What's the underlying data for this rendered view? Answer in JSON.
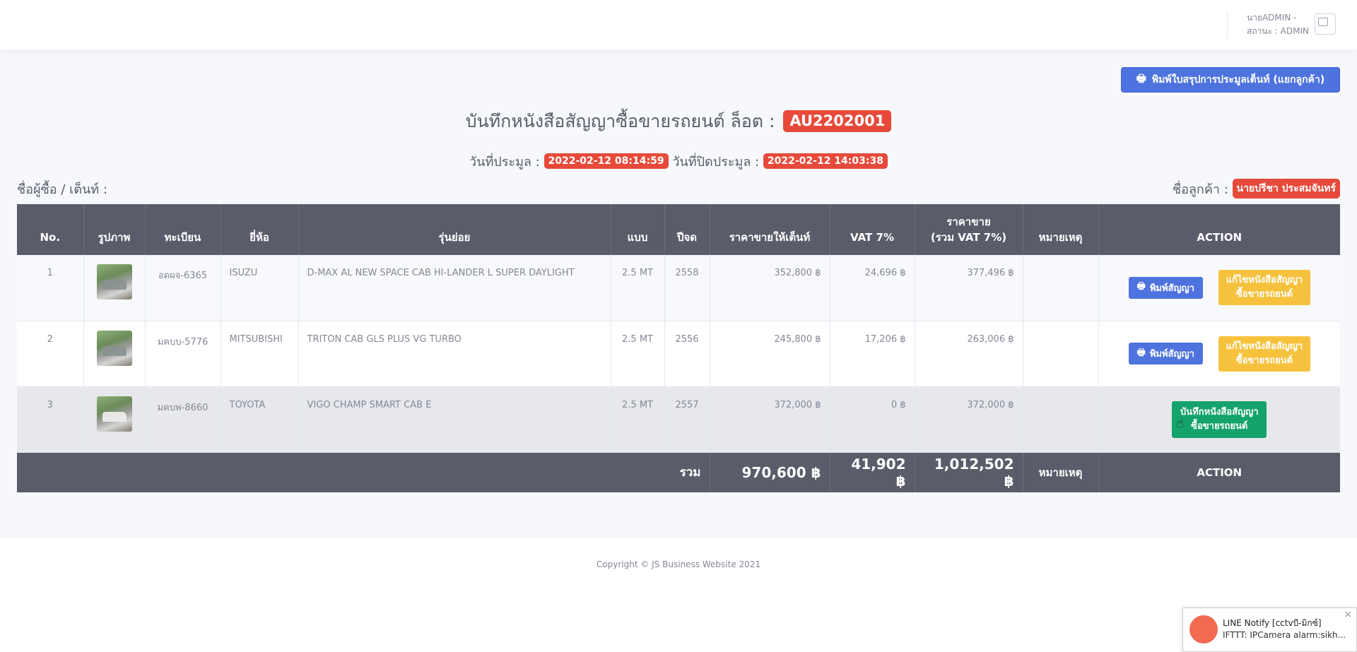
{
  "topbar": {
    "user_name": "นายADMIN -",
    "user_status": "สถานะ : ADMIN"
  },
  "print_summary_button": {
    "icon": "printer-icon",
    "label": "พิมพ์ใบสรุปการประมูลเต็นท์ (แยกลูกค้า)"
  },
  "header": {
    "title": "บันทึกหนังสือสัญญาซื้อขายรถยนต์ ล็อต :",
    "lot": "AU2202001",
    "auction_date_label": "วันที่ประมูล :",
    "auction_date": "2022-02-12 08:14:59",
    "close_date_label": "วันที่ปิดประมูล :",
    "close_date": "2022-02-12 14:03:38",
    "buyer_label": "ชื่อผู้ซื้อ / เต็นท์ :",
    "customer_label": "ชื่อลูกค้า :",
    "customer_name": "นายปรีชา  ประสมจันทร์"
  },
  "table": {
    "columns": [
      "No.",
      "รูปภาพ",
      "ทะเบียน",
      "ยี่ห้อ",
      "รุ่นย่อย",
      "แบบ",
      "ปีจด",
      "ราคาขายให้เต็นท์",
      "VAT 7%",
      "ราคาขาย",
      "(รวม VAT 7%)",
      "หมายเหตุ",
      "ACTION"
    ],
    "rows": [
      {
        "no": "1",
        "plate": "อตผจ-6365",
        "brand": "ISUZU",
        "model": "D-MAX AL NEW SPACE CAB HI-LANDER L SUPER DAYLIGHT",
        "type": "2.5 MT",
        "year": "2558",
        "price": "352,800 ฿",
        "vat": "24,696 ฿",
        "total": "377,496 ฿",
        "note": ""
      },
      {
        "no": "2",
        "plate": "มคบบ-5776",
        "brand": "MITSUBISHI",
        "model": "TRITON CAB GLS PLUS VG TURBO",
        "type": "2.5 MT",
        "year": "2556",
        "price": "245,800 ฿",
        "vat": "17,206 ฿",
        "total": "263,006 ฿",
        "note": ""
      },
      {
        "no": "3",
        "plate": "มคบพ-8660",
        "brand": "TOYOTA",
        "model": "VIGO CHAMP SMART CAB E",
        "type": "2.5 MT",
        "year": "2557",
        "price": "372,000 ฿",
        "vat": "0 ฿",
        "total": "372,000 ฿",
        "note": ""
      }
    ],
    "actions": {
      "print_contract": "พิมพ์สัญญา",
      "edit_line1": "แก้ไขหนังสือสัญญา",
      "edit_line2": "ซื้อขายรถยนต์",
      "save_line1": "บันทึกหนังสือสัญญา",
      "save_line2": "ซื้อขายรถยนต์"
    },
    "footer": {
      "label": "รวม",
      "price": "970,600 ฿",
      "vat": "41,902 ฿",
      "total": "1,012,502 ฿",
      "note": "หมายเหตุ",
      "action": "ACTION"
    }
  },
  "footer": {
    "copyright": "Copyright © JS Business Website 2021"
  },
  "notification": {
    "title": "LINE Notify [cctvบี-มิกซ์]",
    "body": "IFTTT: IPCamera alarm:sikh...",
    "close": "×"
  }
}
